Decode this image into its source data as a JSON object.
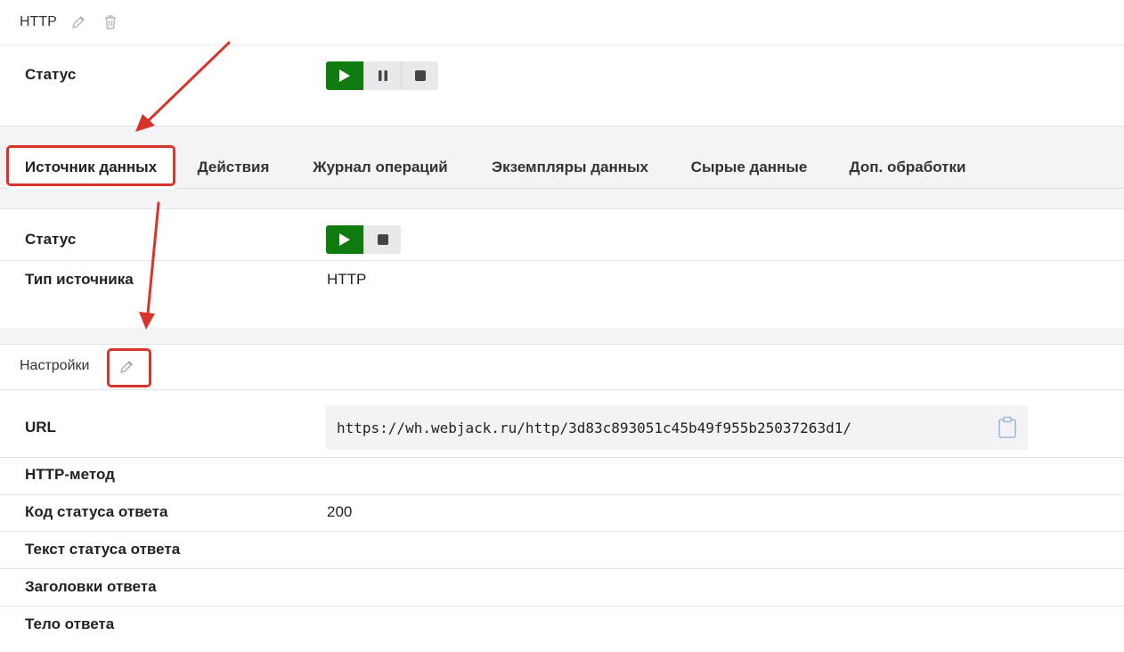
{
  "top_panel": {
    "title": "HTTP",
    "status_label": "Статус"
  },
  "tabs": [
    {
      "label": "Источник данных",
      "active": true
    },
    {
      "label": "Действия",
      "active": false
    },
    {
      "label": "Журнал операций",
      "active": false
    },
    {
      "label": "Экземпляры данных",
      "active": false
    },
    {
      "label": "Сырые данные",
      "active": false
    },
    {
      "label": "Доп. обработки",
      "active": false
    }
  ],
  "source_panel": {
    "status_label": "Статус",
    "type_label": "Тип источника",
    "type_value": "HTTP"
  },
  "settings": {
    "title": "Настройки",
    "url_label": "URL",
    "url_value": "https://wh.webjack.ru/http/3d83c893051c45b49f955b25037263d1/",
    "method_label": "HTTP-метод",
    "method_value": "",
    "status_code_label": "Код статуса ответа",
    "status_code_value": "200",
    "status_text_label": "Текст статуса ответа",
    "status_text_value": "",
    "headers_label": "Заголовки ответа",
    "headers_value": "",
    "body_label": "Тело ответа",
    "body_value": ""
  },
  "icons": {
    "edit": "pencil-icon",
    "delete": "trash-icon",
    "play": "play-icon",
    "pause": "pause-icon",
    "stop": "stop-icon",
    "copy": "clipboard-icon"
  },
  "colors": {
    "play_button": "#107c10",
    "annotation": "#d9342b",
    "page_background": "#f4f4f7"
  }
}
